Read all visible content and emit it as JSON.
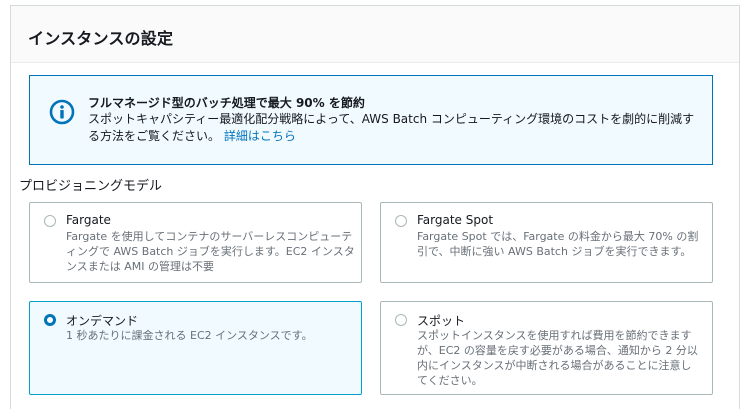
{
  "panel": {
    "title": "インスタンスの設定"
  },
  "info": {
    "icon": "info-icon",
    "title": "フルマネージド型のバッチ処理で最大 90% を節約",
    "body": "スポットキャパシティー最適化配分戦略によって、AWS Batch コンピューティング環境のコストを劇的に削減する方法をご覧ください。",
    "link": "詳細はこちら"
  },
  "provisioning": {
    "label": "プロビジョニングモデル",
    "options": [
      {
        "title": "Fargate",
        "description": "Fargate を使用してコンテナのサーバーレスコンピューティングで AWS Batch ジョブを実行します。EC2 インスタンスまたは AMI の管理は不要",
        "selected": false
      },
      {
        "title": "Fargate Spot",
        "description": "Fargate Spot では、Fargate の料金から最大 70% の割引で、中断に強い AWS Batch ジョブを実行できます。",
        "selected": false
      },
      {
        "title": "オンデマンド",
        "description": "1 秒あたりに課金される EC2 インスタンスです。",
        "selected": true
      },
      {
        "title": "スポット",
        "description": "スポットインスタンスを使用すれば費用を節約できますが、EC2 の容量を戻す必要がある場合、通知から 2 分以内にインスタンスが中断される場合があることに注意してください。",
        "selected": false
      }
    ]
  },
  "colors": {
    "accent": "#0073bb",
    "info_bg": "#f1faff",
    "border": "#aab7b8",
    "muted_text": "#687078"
  }
}
